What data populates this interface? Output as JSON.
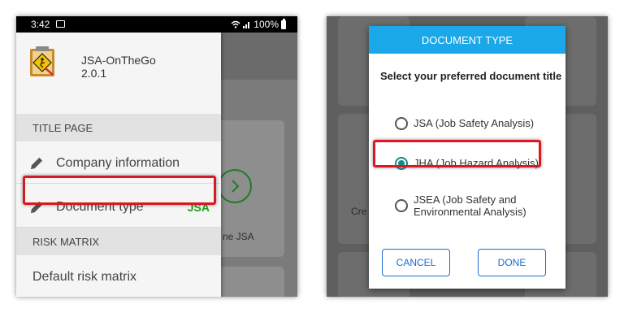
{
  "left_screen": {
    "status_bar": {
      "time": "3:42",
      "battery": "100%"
    },
    "app": {
      "name": "JSA-OnTheGo",
      "version": "2.0.1"
    },
    "drawer": {
      "section_title_page": "TITLE PAGE",
      "items": [
        {
          "label": "Company information"
        },
        {
          "label": "Document type",
          "badge": "JSA"
        }
      ],
      "section_risk_matrix": "RISK MATRIX",
      "risk_items": [
        {
          "label": "Default risk matrix"
        }
      ]
    },
    "background": {
      "card_text": "ne JSA"
    }
  },
  "right_screen": {
    "background": {
      "card_text": "Cre"
    },
    "dialog": {
      "title": "DOCUMENT TYPE",
      "prompt": "Select your preferred document title",
      "options": [
        {
          "label": "JSA (Job Safety Analysis)",
          "selected": false
        },
        {
          "label": "JHA (Job Hazard Analysis)",
          "selected": true
        },
        {
          "label_line1": "JSEA (Job Safety and",
          "label_line2": "Environmental Analysis)",
          "selected": false
        }
      ],
      "cancel_label": "CANCEL",
      "done_label": "DONE"
    }
  },
  "colors": {
    "accent_blue": "#1aa8e8",
    "button_blue": "#1d6ad0",
    "badge_green": "#19a319",
    "highlight_red": "#d71921",
    "radio_teal": "#138a8a"
  }
}
